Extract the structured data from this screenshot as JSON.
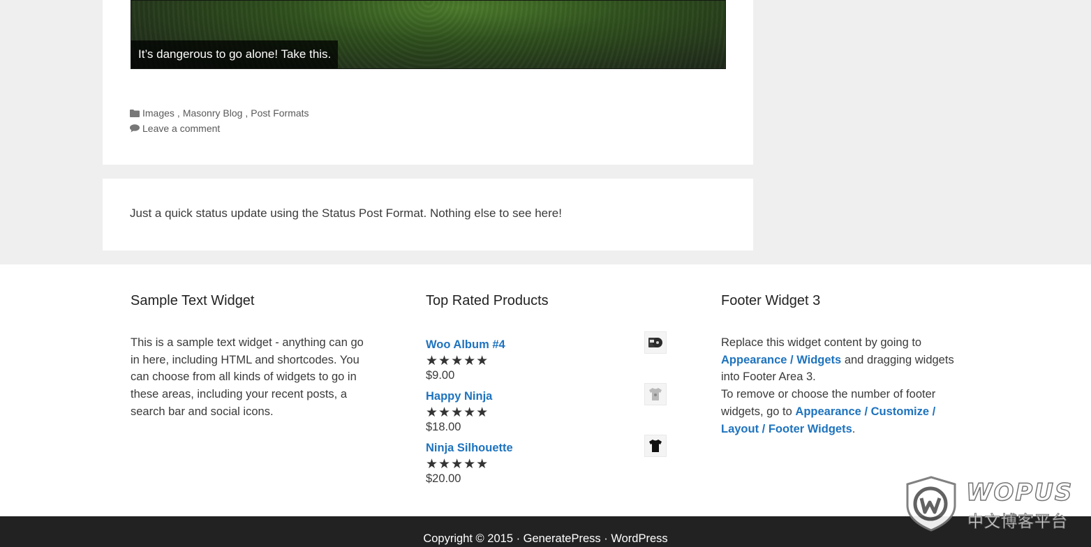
{
  "gallery_post": {
    "caption": "It’s dangerous to go alone! Take this.",
    "categories": [
      "Images",
      "Masonry Blog",
      "Post Formats"
    ],
    "comment_link": "Leave a comment"
  },
  "status_post": {
    "text": "Just a quick status update using the Status Post Format. Nothing else to see here!"
  },
  "footer_widgets": {
    "text_widget": {
      "title": "Sample Text Widget",
      "body": "This is a sample text widget - anything can go in here, including HTML and shortcodes. You can choose from all kinds of widgets to go in these areas, including your recent posts, a search bar and social icons."
    },
    "top_rated": {
      "title": "Top Rated Products",
      "products": [
        {
          "name": "Woo Album #4",
          "rating": 5,
          "stars": "★★★★★",
          "price": "$9.00",
          "thumb_icon": "album-icon"
        },
        {
          "name": "Happy Ninja",
          "rating": 5,
          "stars": "★★★★★",
          "price": "$18.00",
          "thumb_icon": "grey-tshirt-icon"
        },
        {
          "name": "Ninja Silhouette",
          "rating": 5,
          "stars": "★★★★★",
          "price": "$20.00",
          "thumb_icon": "black-tshirt-icon"
        }
      ]
    },
    "widget3": {
      "title": "Footer Widget 3",
      "text1": "Replace this widget content by going to",
      "link1": "Appearance / Widgets",
      "text2": "and dragging widgets into Footer Area 3.",
      "text3": "To remove or choose the number of footer widgets, go to",
      "link2": "Appearance / Customize / Layout / Footer Widgets",
      "text4": "."
    }
  },
  "site_info": {
    "copyright": "Copyright © 2015 ·",
    "theme_link": "GeneratePress",
    "sep": "·",
    "wp_link": "WordPress"
  },
  "watermark": {
    "logo_text": "WOPUS",
    "sub_text": "中文博客平台"
  },
  "colors": {
    "link": "#1e73be",
    "page_bg": "#efefef",
    "footer_bar": "#222222"
  }
}
